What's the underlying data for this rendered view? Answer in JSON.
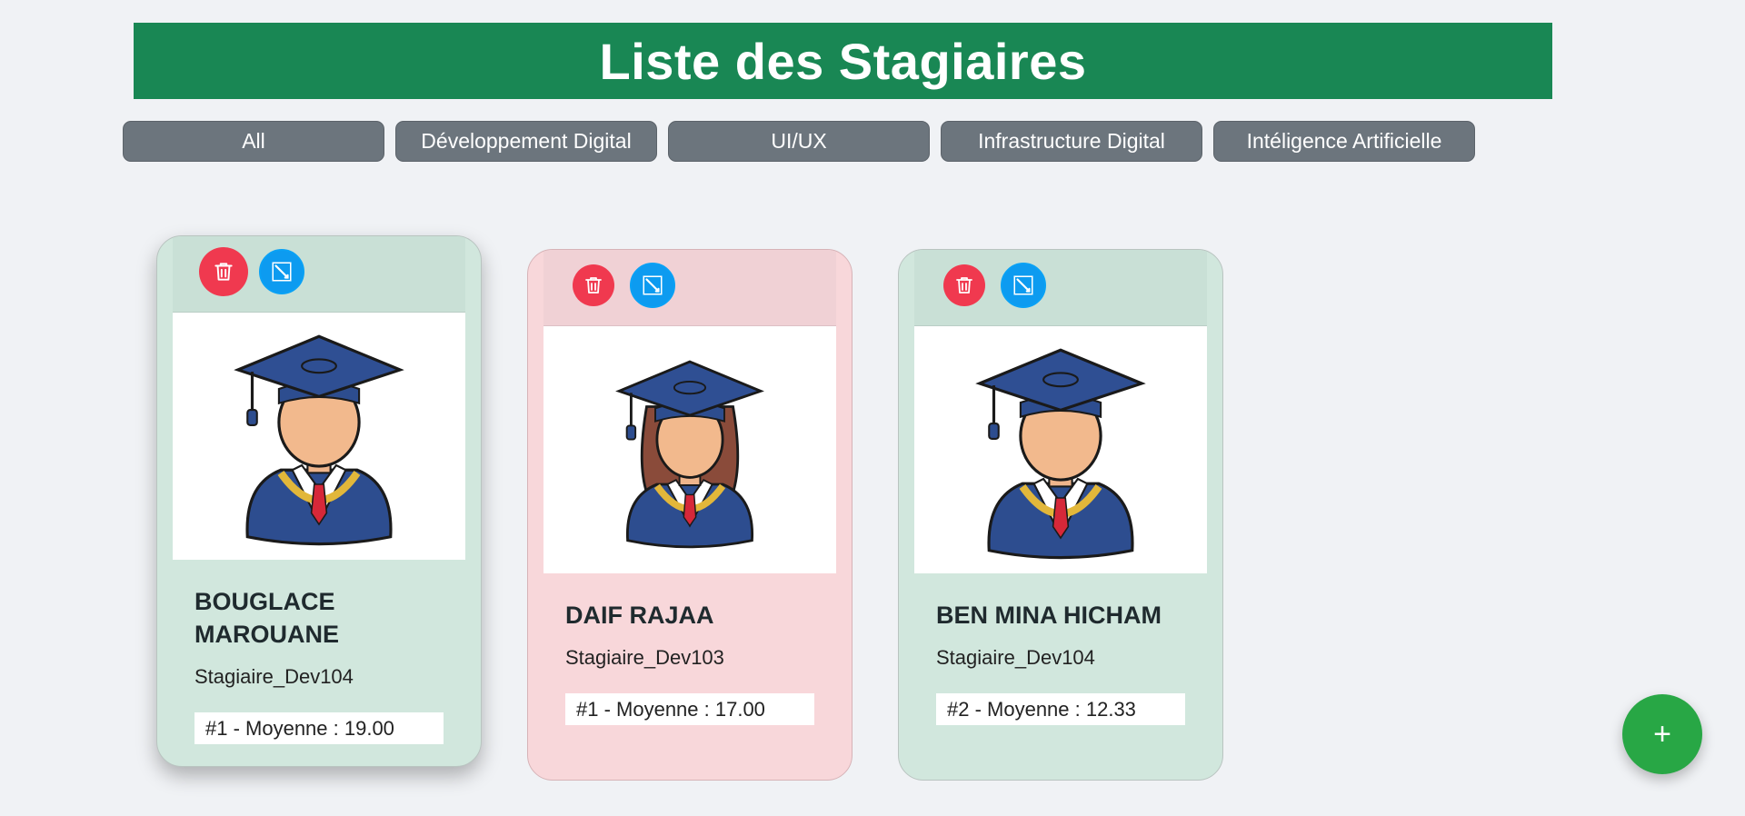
{
  "header": {
    "title": "Liste des Stagiaires"
  },
  "filters": [
    {
      "label": "All"
    },
    {
      "label": "Développement Digital"
    },
    {
      "label": "UI/UX"
    },
    {
      "label": "Infrastructure Digital"
    },
    {
      "label": "Intéligence Artificielle"
    }
  ],
  "cards": [
    {
      "name": "BOUGLACE MAROUANE",
      "group": "Stagiaire_Dev104",
      "average": "#1 - Moyenne : 19.00",
      "color": "#d1e7dd",
      "avatar": "graduate-male-icon"
    },
    {
      "name": "DAIF RAJAA",
      "group": "Stagiaire_Dev103",
      "average": "#1 - Moyenne : 17.00",
      "color": "#f8d7da",
      "avatar": "graduate-female-icon"
    },
    {
      "name": "BEN MINA HICHAM",
      "group": "Stagiaire_Dev104",
      "average": "#2 - Moyenne : 12.33",
      "color": "#d1e7dd",
      "avatar": "graduate-male-icon"
    }
  ],
  "fab": {
    "label": "+"
  },
  "colors": {
    "header": "#198754",
    "filter": "#6c757d",
    "delete": "#f0394f",
    "edit": "#0d9bf0",
    "fab": "#28a745"
  }
}
